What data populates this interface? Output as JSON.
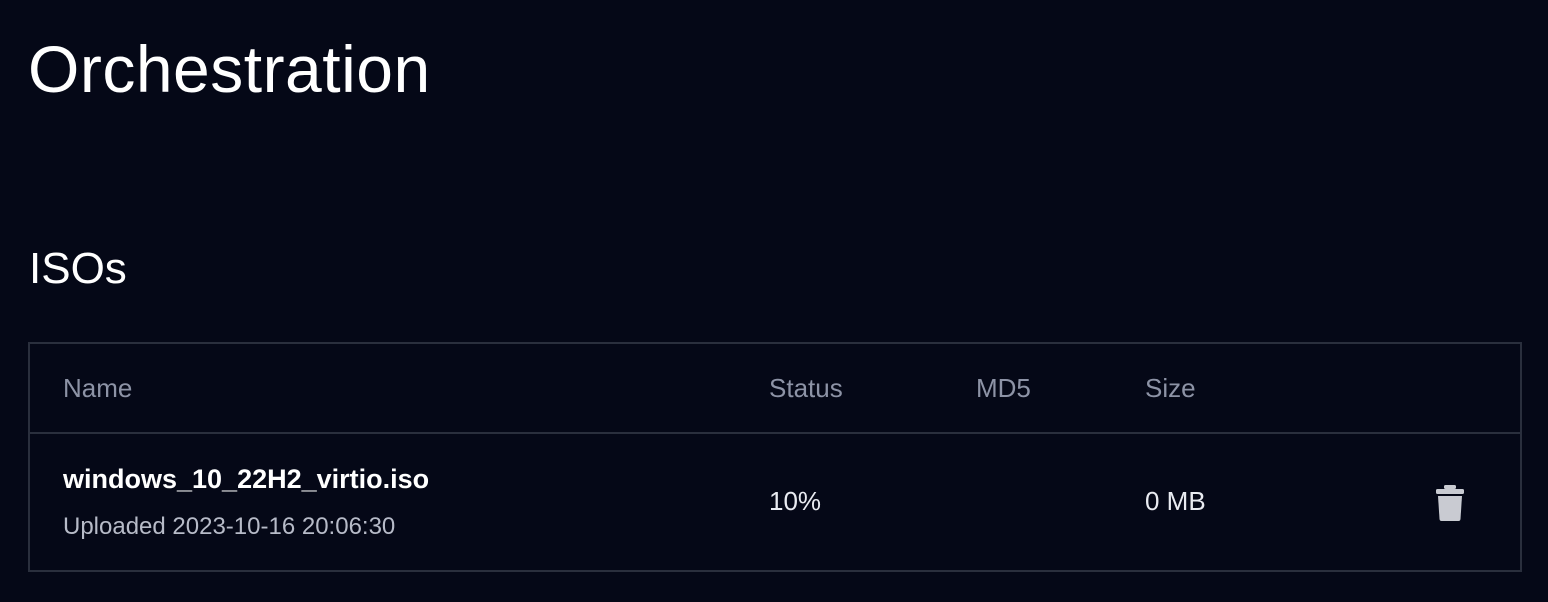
{
  "page": {
    "title": "Orchestration"
  },
  "section": {
    "title": "ISOs"
  },
  "table": {
    "columns": [
      "Name",
      "Status",
      "MD5",
      "Size"
    ],
    "rows": [
      {
        "name": "windows_10_22H2_virtio.iso",
        "uploaded": "Uploaded 2023-10-16 20:06:30",
        "status": "10%",
        "md5": "",
        "size": "0 MB",
        "action_icon": "trash-icon"
      }
    ]
  },
  "colors": {
    "background": "#050817",
    "border": "#2a2f3d",
    "header_text": "#8d93a6",
    "icon": "#c9cbd2"
  }
}
